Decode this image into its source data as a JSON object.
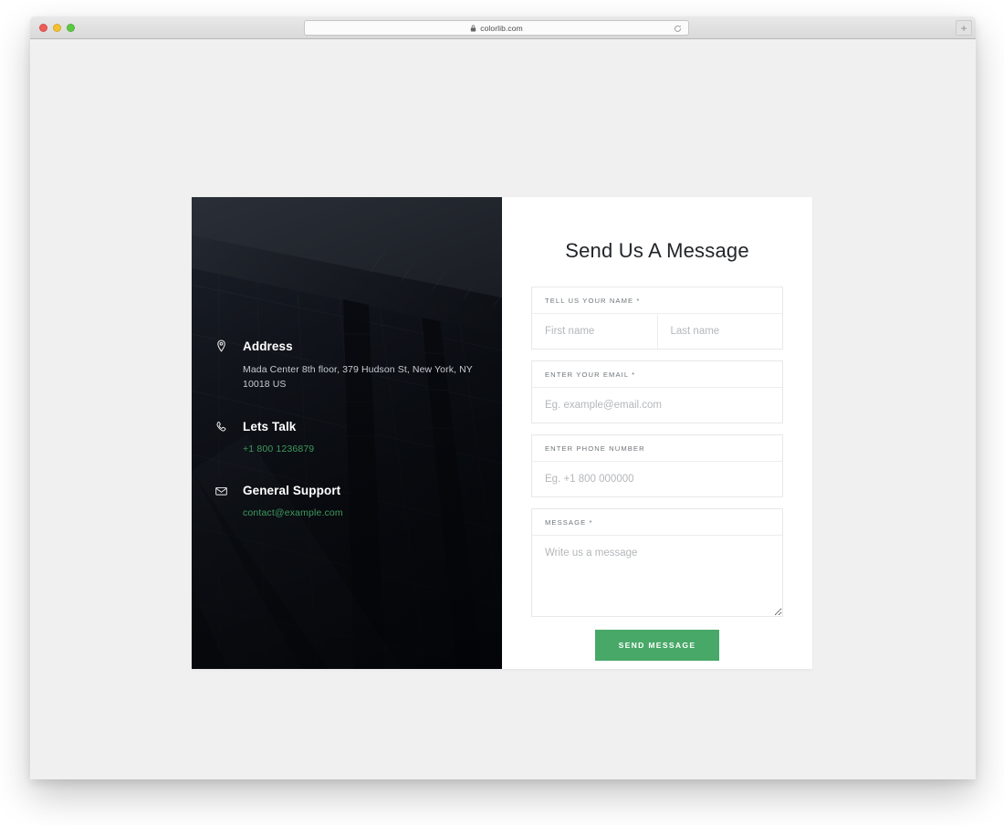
{
  "browser": {
    "url": "colorlib.com",
    "lock_icon": "lock-icon",
    "reload_icon": "reload-icon",
    "new_tab_label": "+",
    "traffic_lights": [
      "close",
      "minimize",
      "maximize"
    ]
  },
  "card": {
    "contact": {
      "blocks": [
        {
          "icon": "map-pin-icon",
          "title": "Address",
          "text": "Mada Center 8th floor, 379 Hudson St, New York, NY 10018 US",
          "link": null
        },
        {
          "icon": "phone-icon",
          "title": "Lets Talk",
          "text": null,
          "link": "+1 800 1236879"
        },
        {
          "icon": "envelope-icon",
          "title": "General Support",
          "text": null,
          "link": "contact@example.com"
        }
      ]
    },
    "form": {
      "title": "Send Us A Message",
      "fields": {
        "name": {
          "label": "TELL US YOUR NAME",
          "required": "*",
          "first_placeholder": "First name",
          "first_value": "",
          "last_placeholder": "Last name",
          "last_value": ""
        },
        "email": {
          "label": "ENTER YOUR EMAIL",
          "required": "*",
          "placeholder": "Eg. example@email.com",
          "value": ""
        },
        "phone": {
          "label": "ENTER PHONE NUMBER",
          "required": "",
          "placeholder": "Eg. +1 800 000000",
          "value": ""
        },
        "message": {
          "label": "MESSAGE",
          "required": "*",
          "placeholder": "Write us a message",
          "value": ""
        }
      },
      "submit_label": "SEND MESSAGE"
    }
  },
  "colors": {
    "accent_green": "#48a868",
    "link_green": "#3f9a5e",
    "page_bg": "#f0f0f0",
    "panel_dark": "#0d1118"
  }
}
